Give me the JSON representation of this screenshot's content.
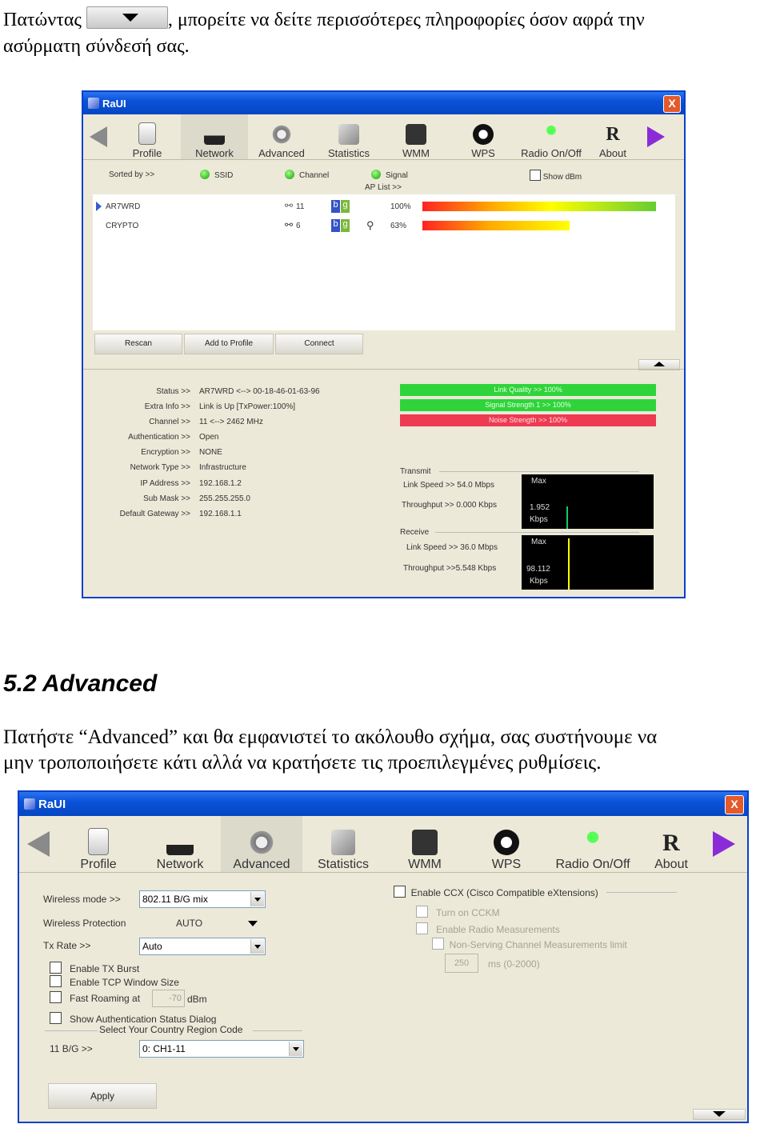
{
  "intro": {
    "line1_before": "Πατώντας",
    "line1_after": ", μπορείτε να δείτε περισσότερες πληροφορίες όσον αφρά την",
    "line2": "ασύρματη σύνδεσή σας."
  },
  "section": {
    "heading": "5.2  Advanced"
  },
  "body": {
    "line1": "Πατήστε “Advanced” και θα εμφανιστεί το ακόλουθο σχήμα, σας συστήνουμε να",
    "line2": "μην τροποποιήσετε κάτι αλλά να κρατήσετε τις προεπιλεγμένες ρυθμίσεις."
  },
  "raui1": {
    "title": "RaUI",
    "close": "X",
    "toolbar": [
      "Profile",
      "Network",
      "Advanced",
      "Statistics",
      "WMM",
      "WPS",
      "Radio On/Off",
      "About"
    ],
    "sort": {
      "sorted_by": "Sorted by >>",
      "ssid": "SSID",
      "channel": "Channel",
      "signal": "Signal",
      "show_dbm": "Show dBm",
      "ap_list": "AP List >>"
    },
    "aps": [
      {
        "ssid": "AR7WRD",
        "channel": "11",
        "mode_b": "b",
        "mode_g": "g",
        "signal": "100%",
        "signal_level": 1.0,
        "secured": false
      },
      {
        "ssid": "CRYPTO",
        "channel": "6",
        "mode_b": "b",
        "mode_g": "g",
        "signal": "63%",
        "signal_level": 0.63,
        "secured": true
      }
    ],
    "buttons": {
      "rescan": "Rescan",
      "add_profile": "Add to Profile",
      "connect": "Connect"
    },
    "info_labels": [
      "Status >>",
      "Extra Info >>",
      "Channel >>",
      "Authentication >>",
      "Encryption >>",
      "Network Type >>",
      "IP Address >>",
      "Sub Mask >>",
      "Default Gateway >>"
    ],
    "info_values": [
      "AR7WRD <--> 00-18-46-01-63-96",
      "Link is Up [TxPower:100%]",
      "11 <--> 2462 MHz",
      "Open",
      "NONE",
      "Infrastructure",
      "192.168.1.2",
      "255.255.255.0",
      "192.168.1.1"
    ],
    "quality": {
      "link": "Link Quality >> 100%",
      "signal": "Signal Strength 1 >> 100%",
      "noise": "Noise Strength >> 100%"
    },
    "transmit": {
      "title": "Transmit",
      "link_speed": "Link Speed >>  54.0 Mbps",
      "throughput": "Throughput >> 0.000 Kbps",
      "max": "Max",
      "value": "1.952",
      "unit": "Kbps"
    },
    "receive": {
      "title": "Receive",
      "link_speed": "Link Speed >> 36.0 Mbps",
      "throughput": "Throughput >>5.548 Kbps",
      "max": "Max",
      "value": "98.112",
      "unit": "Kbps"
    }
  },
  "raui2": {
    "title": "RaUI",
    "close": "X",
    "toolbar": [
      "Profile",
      "Network",
      "Advanced",
      "Statistics",
      "WMM",
      "WPS",
      "Radio On/Off",
      "About"
    ],
    "wireless_mode_label": "Wireless mode >>",
    "wireless_mode_value": "802.11 B/G mix",
    "wireless_protection_label": "Wireless Protection",
    "wireless_protection_value": "AUTO",
    "tx_rate_label": "Tx Rate >>",
    "tx_rate_value": "Auto",
    "enable_tx_burst": "Enable TX Burst",
    "enable_tcp": "Enable TCP Window Size",
    "fast_roaming": "Fast Roaming at",
    "fast_roaming_value": "-70",
    "dbm": "dBm",
    "show_auth": "Show Authentication Status Dialog",
    "country_title": "Select Your Country Region Code",
    "country_label": "11 B/G >>",
    "country_value": "0: CH1-11",
    "apply": "Apply",
    "ccx": "Enable CCX (Cisco Compatible eXtensions)",
    "cckm": "Turn on CCKM",
    "radio_meas": "Enable Radio Measurements",
    "non_serving": "Non-Serving Channel Measurements limit",
    "ms_value": "250",
    "ms_unit": "ms (0-2000)"
  }
}
